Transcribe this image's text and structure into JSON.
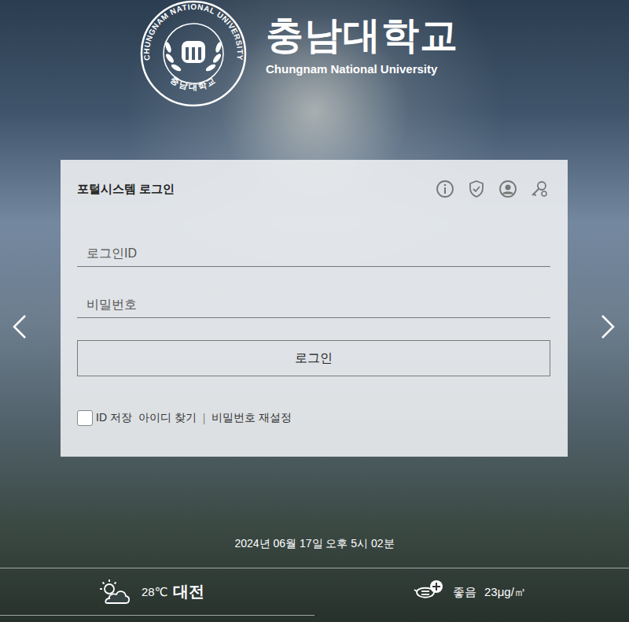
{
  "logo": {
    "seal_top": "CHUNGNAM NATIONAL UNIVERSITY",
    "seal_bottom": "충남대학교",
    "name_ko": "충남대학교",
    "name_en": "Chungnam National University"
  },
  "login": {
    "title": "포털시스템 로그인",
    "id_placeholder": "로그인ID",
    "password_placeholder": "비밀번호",
    "submit": "로그인",
    "remember": {
      "label": "ID 저장",
      "checked": false
    },
    "links": [
      "아이디 찾기",
      "비밀번호 재설정"
    ],
    "separator": "|"
  },
  "datetime": "2024년 06월 17일 오후 5시 02분",
  "weather": {
    "temperature": "28℃",
    "city": "대전"
  },
  "air": {
    "status": "좋음",
    "value": "23μg/㎥"
  }
}
